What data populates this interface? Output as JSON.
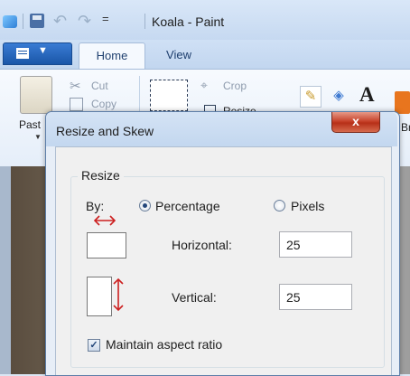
{
  "app": {
    "window_title": "Koala - Paint",
    "quick_access": {
      "save_icon": "save-icon",
      "undo_icon": "undo-icon",
      "redo_icon": "redo-icon",
      "dropdown_glyph": "="
    }
  },
  "ribbon": {
    "tabs": [
      {
        "label": "Home",
        "active": true
      },
      {
        "label": "View",
        "active": false
      }
    ],
    "clipboard": {
      "paste_label": "Past",
      "cut_label": "Cut",
      "copy_label": "Copy"
    },
    "image": {
      "crop_label": "Crop",
      "resize_label": "Resize"
    },
    "brushes_label": "Br"
  },
  "dialog": {
    "title": "Resize and Skew",
    "close_glyph": "x",
    "resize_group": {
      "label": "Resize",
      "by_label": "By:",
      "options": [
        {
          "label": "Percentage",
          "selected": true
        },
        {
          "label": "Pixels",
          "selected": false
        }
      ],
      "horizontal": {
        "label": "Horizontal:",
        "value": "25"
      },
      "vertical": {
        "label": "Vertical:",
        "value": "25"
      },
      "maintain_aspect_ratio": {
        "label": "Maintain aspect ratio",
        "checked": true
      }
    }
  },
  "colors": {
    "accent_blue": "#1a56a8",
    "close_red": "#c8442c",
    "arrow_red": "#cc1f1f",
    "dialog_bg": "#f0f0f0"
  }
}
